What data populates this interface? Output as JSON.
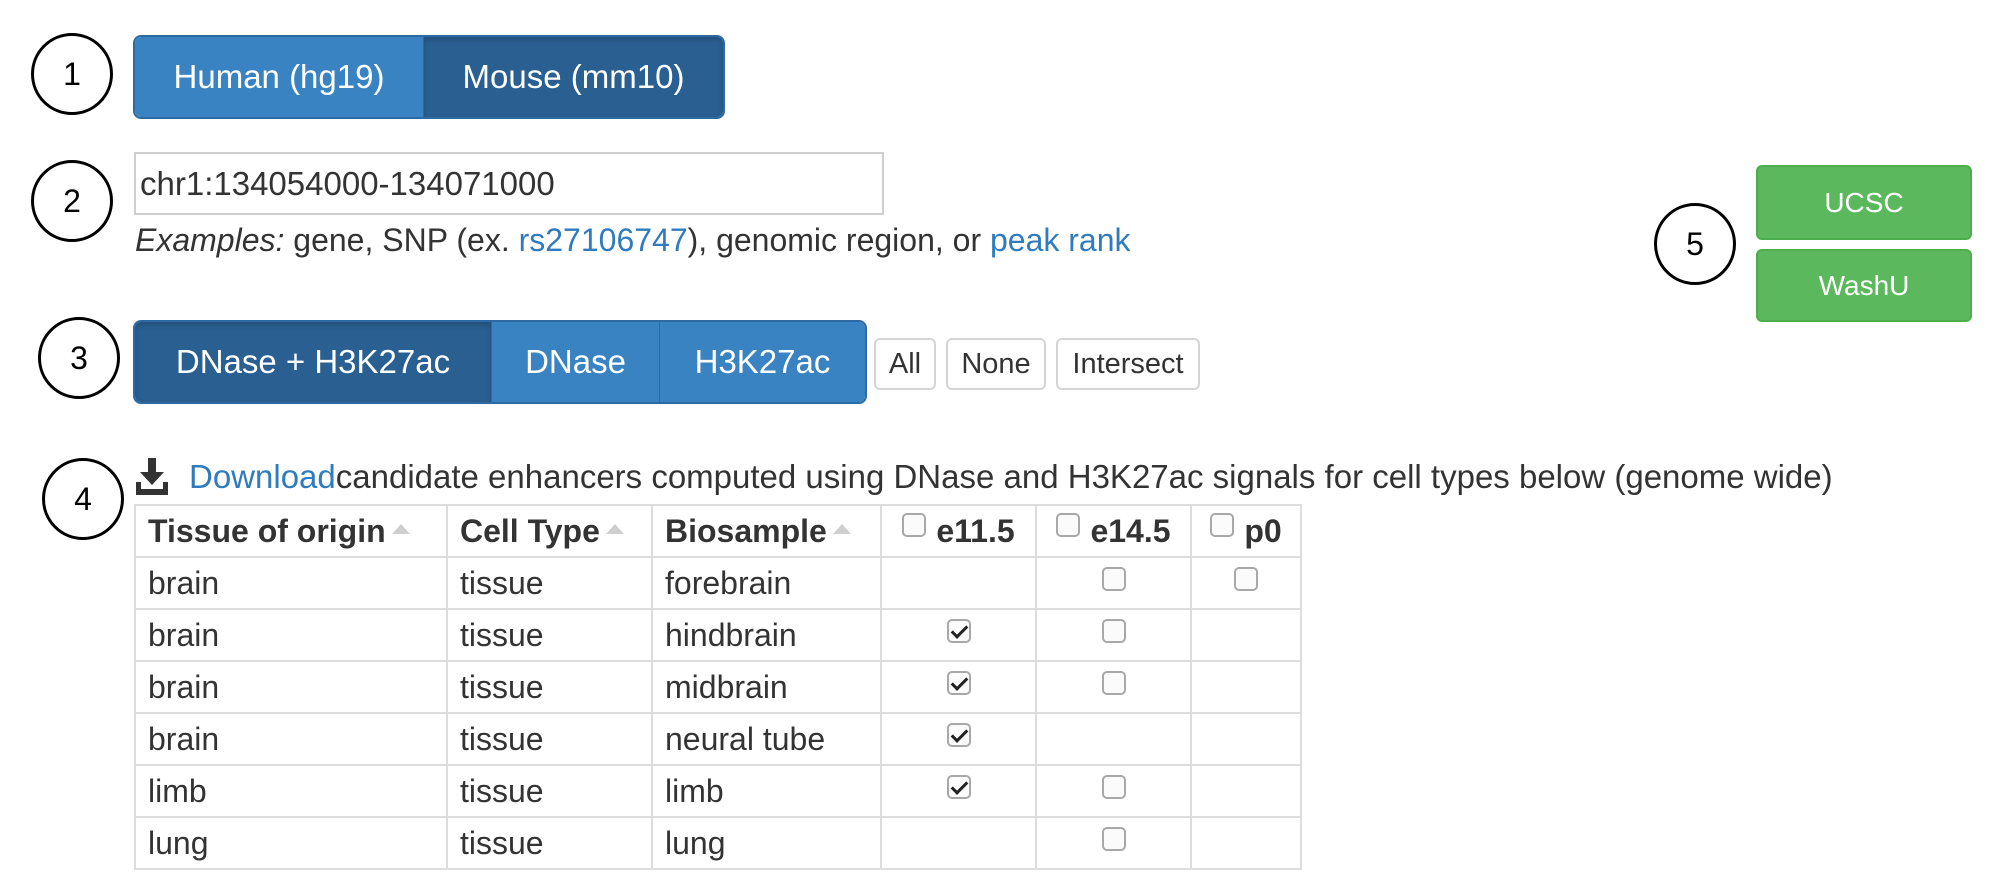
{
  "step_numbers": [
    "1",
    "2",
    "3",
    "4",
    "5"
  ],
  "genome": {
    "options": [
      {
        "label": "Human (hg19)",
        "active": false
      },
      {
        "label": "Mouse (mm10)",
        "active": true
      }
    ]
  },
  "search": {
    "value": "chr1:134054000-134071000",
    "examples_prefix": "Examples:",
    "examples_text1": " gene, SNP (ex. ",
    "example_snp": "rs27106747",
    "examples_text2": "), genomic region, or ",
    "example_peak": "peak rank"
  },
  "assay": {
    "options": [
      {
        "label": "DNase + H3K27ac",
        "active": true
      },
      {
        "label": "DNase",
        "active": false
      },
      {
        "label": "H3K27ac",
        "active": false
      }
    ],
    "select_all": "All",
    "select_none": "None",
    "select_intersect": "Intersect"
  },
  "browsers": {
    "ucsc": "UCSC",
    "washu": "WashU"
  },
  "download": {
    "icon": "download-icon",
    "link": "Download",
    "text": " candidate enhancers computed using DNase and H3K27ac signals for cell types below (genome wide)"
  },
  "table": {
    "headers": [
      "Tissue of origin",
      "Cell Type",
      "Biosample",
      "e11.5",
      "e14.5",
      "p0"
    ],
    "rows": [
      {
        "tissue": "brain",
        "cell_type": "tissue",
        "biosample": "forebrain",
        "e11_5": null,
        "e14_5": false,
        "p0": false
      },
      {
        "tissue": "brain",
        "cell_type": "tissue",
        "biosample": "hindbrain",
        "e11_5": true,
        "e14_5": false,
        "p0": null
      },
      {
        "tissue": "brain",
        "cell_type": "tissue",
        "biosample": "midbrain",
        "e11_5": true,
        "e14_5": false,
        "p0": null
      },
      {
        "tissue": "brain",
        "cell_type": "tissue",
        "biosample": "neural tube",
        "e11_5": true,
        "e14_5": null,
        "p0": null
      },
      {
        "tissue": "limb",
        "cell_type": "tissue",
        "biosample": "limb",
        "e11_5": true,
        "e14_5": false,
        "p0": null
      },
      {
        "tissue": "lung",
        "cell_type": "tissue",
        "biosample": "lung",
        "e11_5": null,
        "e14_5": false,
        "p0": null
      }
    ]
  },
  "colors": {
    "primary": "#3a83c2",
    "primary_active": "#2a5f92",
    "success": "#5cb85c",
    "link": "#2f7bbd"
  }
}
